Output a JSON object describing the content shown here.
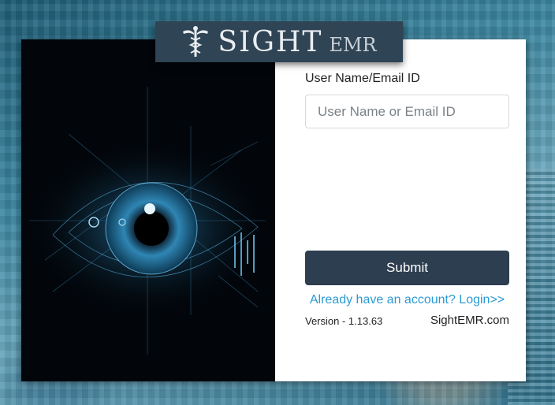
{
  "logo": {
    "main": "SIGHT",
    "sub": "EMR"
  },
  "login_form": {
    "username_label": "User Name/Email ID",
    "username_placeholder": "User Name or Email ID",
    "username_value": "",
    "submit_label": "Submit",
    "login_link": "Already have an account? Login>>"
  },
  "footer": {
    "version": "Version - 1.13.63",
    "site": "SightEMR.com"
  },
  "colors": {
    "logo_bg": "#2f4454",
    "button_bg": "#2d3e50",
    "link": "#2b9ad1",
    "eye_glow": "#2e8fc4"
  },
  "images": {
    "hero": "digital-eye-illustration"
  }
}
